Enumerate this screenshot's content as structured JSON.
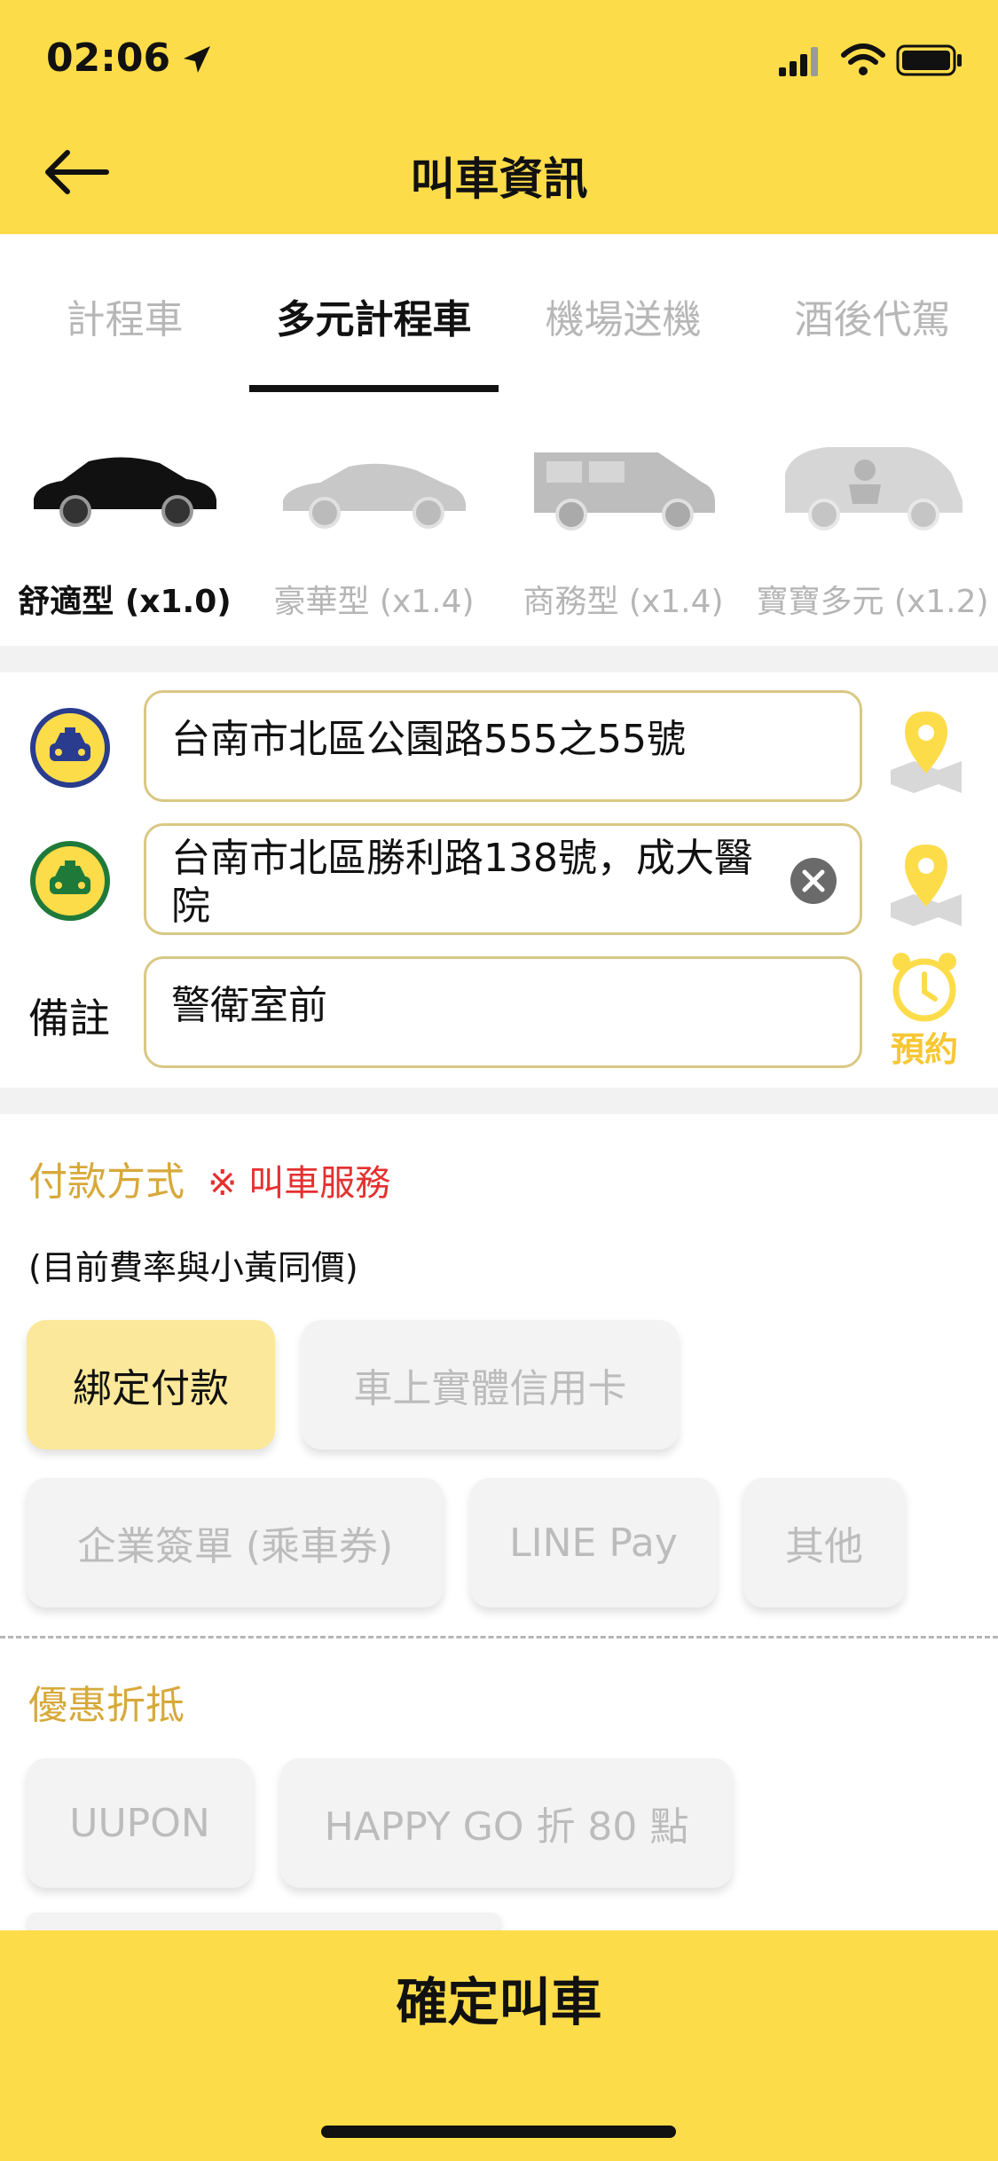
{
  "status": {
    "time": "02:06"
  },
  "header": {
    "title": "叫車資訊"
  },
  "tabs": [
    "計程車",
    "多元計程車",
    "機場送機",
    "酒後代駕"
  ],
  "active_tab": 1,
  "car_types": [
    {
      "label": "舒適型 (x1.0)"
    },
    {
      "label": "豪華型 (x1.4)"
    },
    {
      "label": "商務型 (x1.4)"
    },
    {
      "label": "寶寶多元 (x1.2)"
    }
  ],
  "address": {
    "pickup": "台南市北區公園路555之55號",
    "dropoff": "台南市北區勝利路138號，成大醫院",
    "note_label": "備註",
    "note_value": "警衛室前",
    "reserve_label": "預約"
  },
  "payment": {
    "title": "付款方式",
    "notice": "※ 叫車服務",
    "rate_note": "(目前費率與小黃同價)",
    "options": [
      "綁定付款",
      "車上實體信用卡",
      "企業簽單 (乘車券)",
      "LINE Pay",
      "其他"
    ]
  },
  "discount": {
    "title": "優惠折抵",
    "options": [
      "UUPON",
      "HAPPY GO 折 80 點"
    ]
  },
  "confirm": {
    "label": "確定叫車"
  },
  "colors": {
    "brand_yellow": "#fddc4a",
    "gold_text": "#d7a93a",
    "notice_red": "#e53030"
  }
}
